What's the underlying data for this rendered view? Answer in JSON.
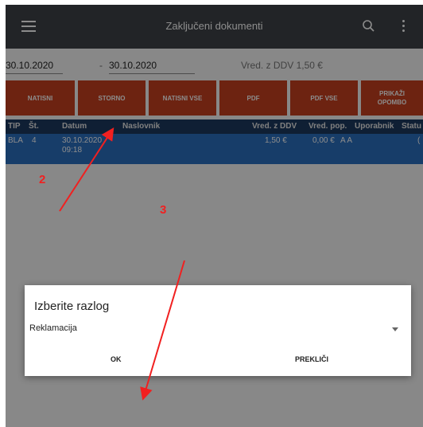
{
  "appbar": {
    "title": "Zaključeni dokumenti"
  },
  "filter": {
    "date_from": "30.10.2020",
    "separator": "-",
    "date_to": "30.10.2020",
    "total": "Vred. z DDV 1,50 €"
  },
  "buttons": [
    "NATISNI",
    "STORNO",
    "NATISNI VSE",
    "PDF",
    "PDF VSE",
    "PRIKAŽI OPOMBO"
  ],
  "table": {
    "headers": [
      "TIP",
      "Št.",
      "Datum",
      "Naslovnik",
      "Vred. z DDV",
      "Vred. pop.",
      "Uporabnik",
      "Statu"
    ],
    "row": {
      "tip": "BLA",
      "st": "4",
      "date": "30.10.2020",
      "time": "09:18",
      "vred": "1,50 €",
      "pop": "0,00 €",
      "user": "A A",
      "status": "("
    }
  },
  "dialog": {
    "title": "Izberite razlog",
    "selected": "Reklamacija",
    "ok": "OK",
    "cancel": "PREKLIČI"
  },
  "annotations": {
    "a2": "2",
    "a3": "3",
    "color": "#f12020"
  },
  "colors": {
    "appbar": "#3e4247",
    "button": "#c6401f",
    "header": "#1d3a5f",
    "selected_row": "#2a6fc0"
  }
}
